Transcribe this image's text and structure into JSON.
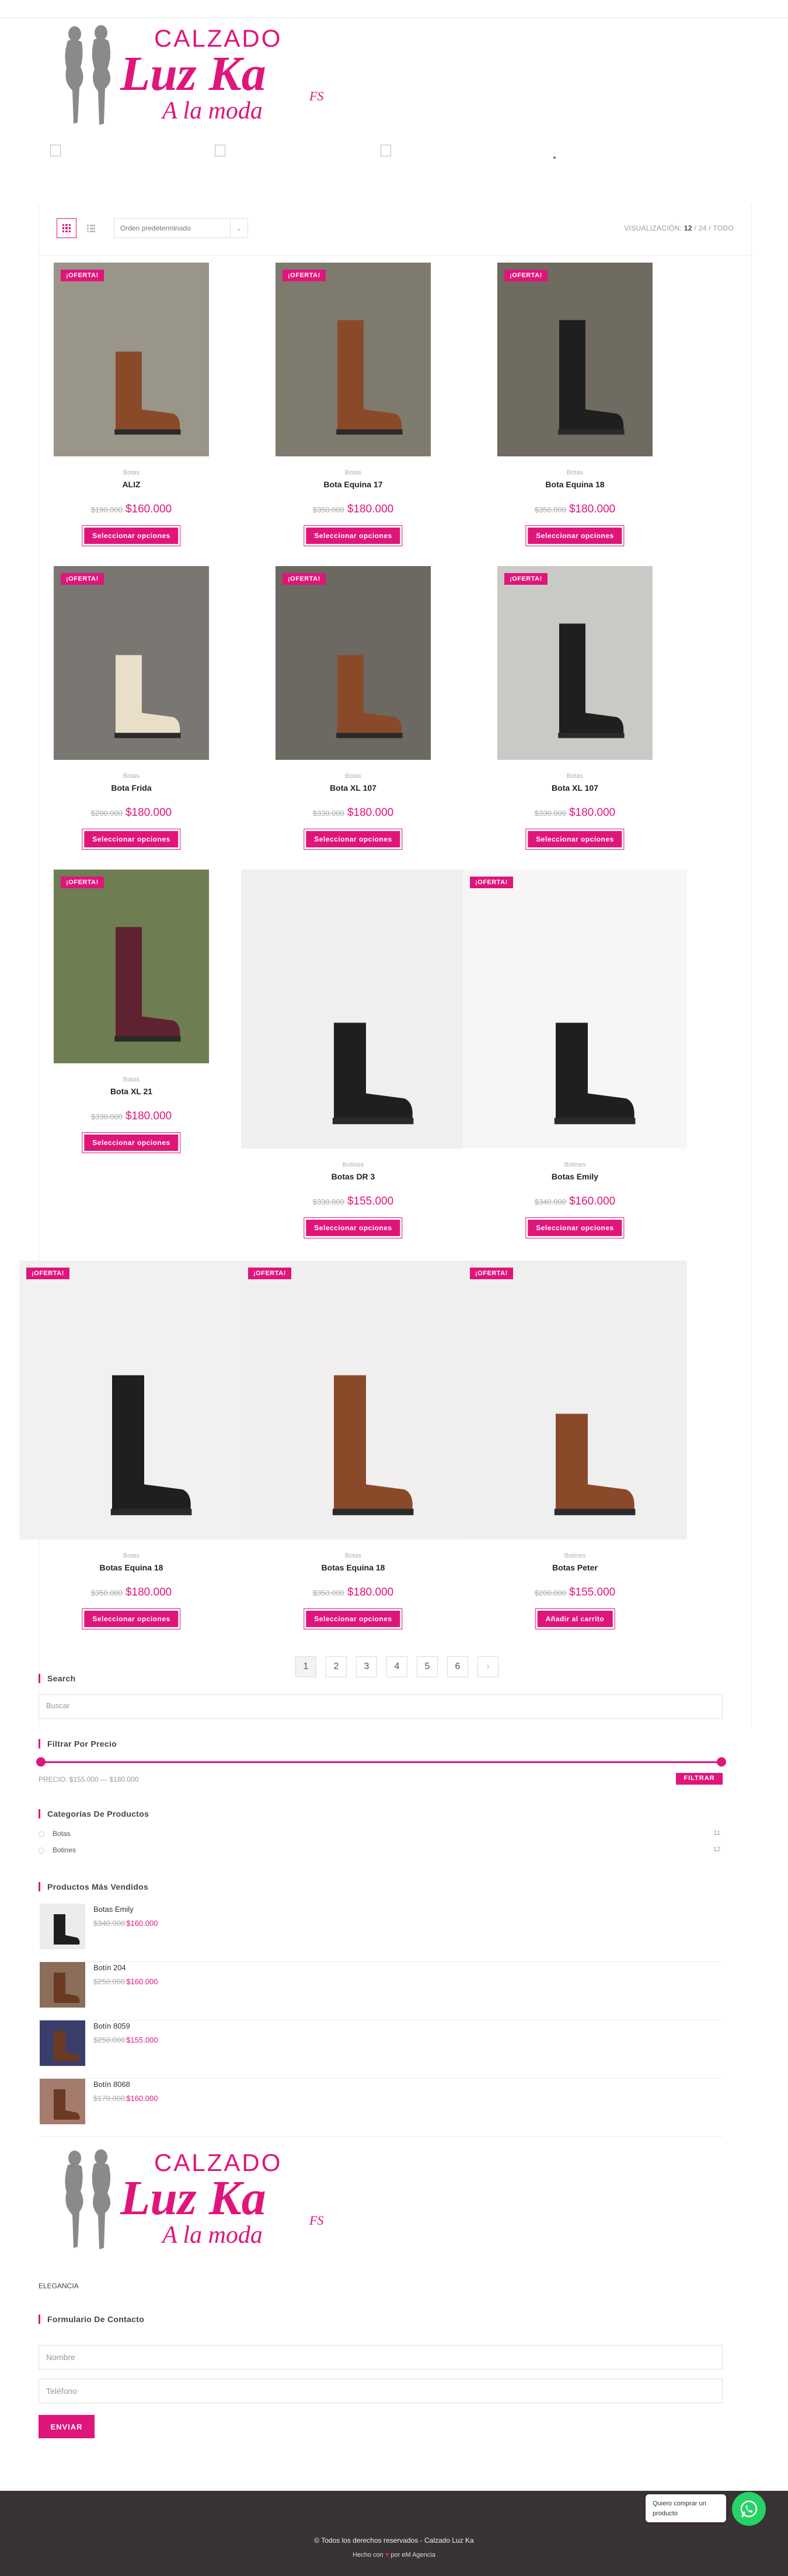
{
  "brand": {
    "line1": "CALZADO",
    "line2": "Luz Ka",
    "line3": "A la moda",
    "mark": "FS",
    "pink": "#e0157a"
  },
  "toolbar": {
    "order": "Orden predeterminado",
    "visual_label": "VISUALIZACIÓN:",
    "visual_current": "12",
    "visual_rest": "/ 24 / TODO"
  },
  "badge": "¡OFERTA!",
  "products": [
    {
      "category": "Botas",
      "title": "ALIZ",
      "old": "$190.000",
      "price": "$160.000",
      "button": "Seleccionar opciones"
    },
    {
      "category": "Botas",
      "title": "Bota Equina 17",
      "old": "$350.000",
      "price": "$180.000",
      "button": "Seleccionar opciones"
    },
    {
      "category": "Botas",
      "title": "Bota Equina 18",
      "old": "$350.000",
      "price": "$180.000",
      "button": "Seleccionar opciones"
    },
    {
      "category": "Botas",
      "title": "Bota Frida",
      "old": "$200.000",
      "price": "$180.000",
      "button": "Seleccionar opciones"
    },
    {
      "category": "Botas",
      "title": "Bota XL 107",
      "old": "$330.000",
      "price": "$180.000",
      "button": "Seleccionar opciones"
    },
    {
      "category": "Botas",
      "title": "Bota XL 107",
      "old": "$330.000",
      "price": "$180.000",
      "button": "Seleccionar opciones"
    },
    {
      "category": "Botas",
      "title": "Bota XL 21",
      "old": "$330.000",
      "price": "$180.000",
      "button": "Seleccionar opciones"
    },
    {
      "category": "Botines",
      "title": "Botas DR 3",
      "old": "$330.000",
      "price": "$155.000",
      "button": "Seleccionar opciones"
    },
    {
      "category": "Botines",
      "title": "Botas Emily",
      "old": "$340.000",
      "price": "$160.000",
      "button": "Seleccionar opciones"
    },
    {
      "category": "Botas",
      "title": "Botas Equina 18",
      "old": "$350.000",
      "price": "$180.000",
      "button": "Seleccionar opciones"
    },
    {
      "category": "Botas",
      "title": "Botas Equina 18",
      "old": "$350.000",
      "price": "$180.000",
      "button": "Seleccionar opciones"
    },
    {
      "category": "Botines",
      "title": "Botas Peter",
      "old": "$200.000",
      "price": "$155.000",
      "button": "Añadir al carrito"
    }
  ],
  "pagination": [
    "1",
    "2",
    "3",
    "4",
    "5",
    "6"
  ],
  "sidebar": {
    "search_title": "Search",
    "search_placeholder": "Buscar",
    "filter_title": "Filtrar Por Precio",
    "price_text": "PRECIO: $155.000 — $180.000",
    "filter_button": "FILTRAR",
    "categories_title": "Categorías De Productos",
    "categories": [
      {
        "name": "Botas",
        "count": "11"
      },
      {
        "name": "Botines",
        "count": "12"
      }
    ],
    "best_title": "Productos Más Vendidos",
    "best": [
      {
        "name": "Botas Emily",
        "old": "$340.000",
        "price": "$160.000"
      },
      {
        "name": "Botín 204",
        "old": "$250.000",
        "price": "$160.000"
      },
      {
        "name": "Botín 8059",
        "old": "$250.000",
        "price": "$155.000"
      },
      {
        "name": "Botín 8068",
        "old": "$170.000",
        "price": "$160.000"
      }
    ]
  },
  "footer": {
    "elegancia": "ELEGANCIA",
    "form_title": "Formulario De Contacto",
    "name_placeholder": "Nombre",
    "phone_placeholder": "Teléfono",
    "send": "ENVIAR",
    "copyright": "© Todos los derechos reservados - Calzado Luz Ka",
    "made_prefix": "Hecho con",
    "made_suffix": "por eM Agencia",
    "whatsapp_text": "Quiero comprar un producto"
  }
}
